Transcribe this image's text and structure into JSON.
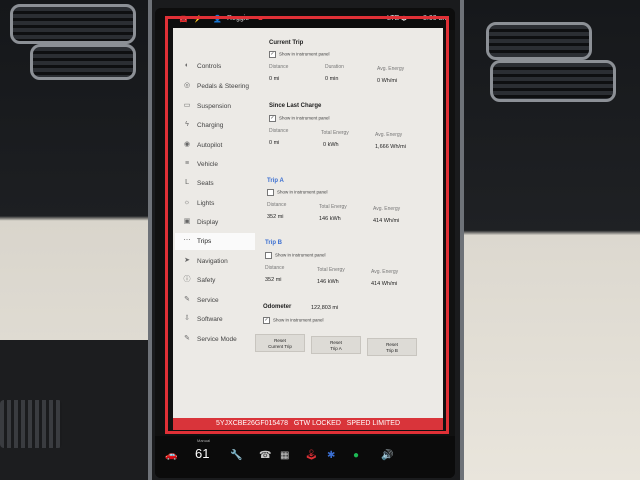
{
  "status_bar": {
    "profile": "Reggie",
    "network": "LTE",
    "time": "8:00 am"
  },
  "sidebar": {
    "items": [
      {
        "label": "Controls",
        "icon": "toggle-icon"
      },
      {
        "label": "Pedals & Steering",
        "icon": "steering-icon"
      },
      {
        "label": "Suspension",
        "icon": "car-icon"
      },
      {
        "label": "Charging",
        "icon": "bolt-icon"
      },
      {
        "label": "Autopilot",
        "icon": "autopilot-icon"
      },
      {
        "label": "Vehicle",
        "icon": "sliders-icon"
      },
      {
        "label": "Seats",
        "icon": "seat-icon"
      },
      {
        "label": "Lights",
        "icon": "light-icon"
      },
      {
        "label": "Display",
        "icon": "display-icon"
      },
      {
        "label": "Trips",
        "icon": "trips-icon"
      },
      {
        "label": "Navigation",
        "icon": "navigation-icon"
      },
      {
        "label": "Safety",
        "icon": "safety-icon"
      },
      {
        "label": "Service",
        "icon": "wrench-icon"
      },
      {
        "label": "Software",
        "icon": "download-icon"
      },
      {
        "label": "Service Mode",
        "icon": "wrench-icon"
      }
    ]
  },
  "current_trip": {
    "title": "Current Trip",
    "checkbox": "Show in instrument panel",
    "distance_label": "Distance",
    "duration_label": "Duration",
    "avg_label": "Avg. Energy",
    "distance": "0 mi",
    "duration": "0 min",
    "avg": "0 Wh/mi"
  },
  "last_charge": {
    "title": "Since Last Charge",
    "checkbox": "Show in instrument panel",
    "distance_label": "Distance",
    "energy_label": "Total Energy",
    "avg_label": "Avg. Energy",
    "distance": "0 mi",
    "energy": "0 kWh",
    "avg": "1,666 Wh/mi"
  },
  "trip_a": {
    "title": "Trip A",
    "checkbox": "Show in instrument panel",
    "distance_label": "Distance",
    "energy_label": "Total Energy",
    "avg_label": "Avg. Energy",
    "distance": "352 mi",
    "energy": "146 kWh",
    "avg": "414 Wh/mi"
  },
  "trip_b": {
    "title": "Trip B",
    "checkbox": "Show in instrument panel",
    "distance_label": "Distance",
    "energy_label": "Total Energy",
    "avg_label": "Avg. Energy",
    "distance": "352 mi",
    "energy": "146 kWh",
    "avg": "414 Wh/mi"
  },
  "odometer": {
    "label": "Odometer",
    "value": "122,803 mi",
    "checkbox": "Show in instrument panel"
  },
  "buttons": {
    "reset_current": [
      "Reset",
      "Current Trip"
    ],
    "reset_a": [
      "Reset",
      "Trip A"
    ],
    "reset_b": [
      "Reset",
      "Trip B"
    ]
  },
  "overlay": {
    "vin": "5YJXCBE26GF015478",
    "lock": "GTW LOCKED",
    "speed": "SPEED LIMITED"
  },
  "bottom_bar": {
    "temp_mode": "Manual",
    "temperature": "61"
  },
  "colors": {
    "accent_red": "#e03036",
    "section_blue": "#3b6fd1",
    "panel_bg": "#eceae6"
  }
}
